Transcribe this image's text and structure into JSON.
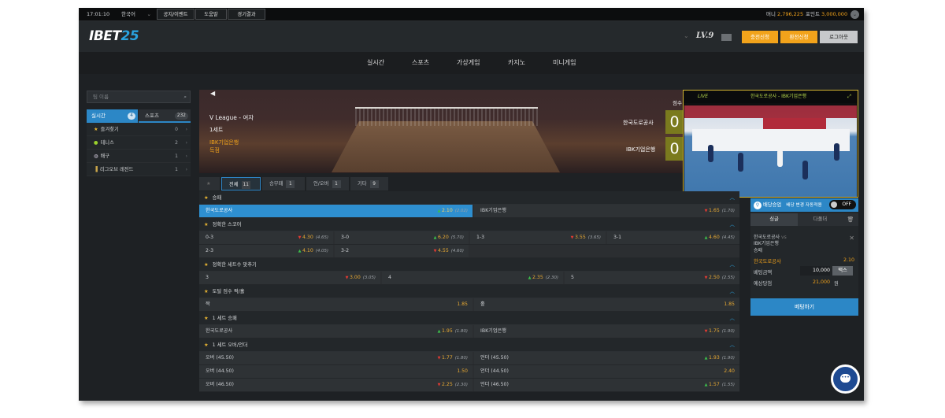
{
  "topbar": {
    "time": "17:01:10",
    "language": "한국어",
    "buttons": [
      "공지/이벤트",
      "도움말",
      "경기결과"
    ],
    "money_label": "머니",
    "money_value": "2,796,225",
    "point_label": "포인트",
    "point_value": "3,000,000"
  },
  "header": {
    "logo_a": "IBET",
    "logo_b": "25",
    "level": "LV.9",
    "deposit": "충전신청",
    "withdraw": "환전신청",
    "logout": "로그아웃"
  },
  "nav": [
    "실시간",
    "스포츠",
    "가상게임",
    "카지노",
    "미니게임"
  ],
  "sidebar": {
    "search_placeholder": "팀 이름",
    "tab_live": "실시간",
    "tab_live_count": "4",
    "tab_sports": "스포츠",
    "tab_sports_count": "232",
    "items": [
      {
        "label": "즐겨찾기",
        "count": "0",
        "icon": "star-icon"
      },
      {
        "label": "테니스",
        "count": "2",
        "icon": "tennis-ball-icon"
      },
      {
        "label": "배구",
        "count": "1",
        "icon": "volleyball-icon"
      },
      {
        "label": "리그오브 레전드",
        "count": "1",
        "icon": "lol-icon"
      }
    ]
  },
  "match": {
    "league": "V League - 여자",
    "period": "1세트",
    "event_team": "IBK기업은행",
    "event_text": "득점",
    "score_header": "점수",
    "home": "한국도로공사",
    "away": "IBK기업은행",
    "home_score": "0",
    "away_score": "0"
  },
  "video": {
    "live": "LIVE",
    "title": "한국도로공사 - IBK기업은행"
  },
  "tabs": [
    {
      "label": "전체",
      "count": "11"
    },
    {
      "label": "승무패",
      "count": "1"
    },
    {
      "label": "언/오버",
      "count": "1"
    },
    {
      "label": "기타",
      "count": "9"
    }
  ],
  "markets": [
    {
      "title": "승패",
      "rows": [
        [
          {
            "label": "한국도로공사",
            "odds": "2.10",
            "prev": "(2.02)",
            "dir": "u",
            "selected": true
          },
          {
            "label": "IBK기업은행",
            "odds": "1.65",
            "prev": "(1.70)",
            "dir": "d"
          }
        ]
      ]
    },
    {
      "title": "정확한 스코어",
      "rows": [
        [
          {
            "label": "0-3",
            "odds": "4.30",
            "prev": "(4.65)",
            "dir": "d"
          },
          {
            "label": "3-0",
            "odds": "6.20",
            "prev": "(5.70)",
            "dir": "u"
          },
          {
            "label": "1-3",
            "odds": "3.55",
            "prev": "(3.65)",
            "dir": "d"
          },
          {
            "label": "3-1",
            "odds": "4.60",
            "prev": "(4.45)",
            "dir": "u"
          }
        ],
        [
          {
            "label": "2-3",
            "odds": "4.10",
            "prev": "(4.05)",
            "dir": "u"
          },
          {
            "label": "3-2",
            "odds": "4.55",
            "prev": "(4.60)",
            "dir": "d"
          }
        ]
      ]
    },
    {
      "title": "정확한 세트수 맞추기",
      "rows": [
        [
          {
            "label": "3",
            "odds": "3.00",
            "prev": "(3.05)",
            "dir": "d"
          },
          {
            "label": "4",
            "odds": "2.35",
            "prev": "(2.30)",
            "dir": "u"
          },
          {
            "label": "5",
            "odds": "2.50",
            "prev": "(2.55)",
            "dir": "d"
          }
        ]
      ]
    },
    {
      "title": "토탈 점수 짝/홀",
      "rows": [
        [
          {
            "label": "짝",
            "odds": "1.85",
            "prev": "",
            "dir": ""
          },
          {
            "label": "홀",
            "odds": "1.85",
            "prev": "",
            "dir": ""
          }
        ]
      ]
    },
    {
      "title": "1 세트 승패",
      "rows": [
        [
          {
            "label": "한국도로공사",
            "odds": "1.95",
            "prev": "(1.80)",
            "dir": "u"
          },
          {
            "label": "IBK기업은행",
            "odds": "1.75",
            "prev": "(1.90)",
            "dir": "d"
          }
        ]
      ]
    },
    {
      "title": "1 세트 오버/언더",
      "rows": [
        [
          {
            "label": "오버 (45.50)",
            "odds": "1.77",
            "prev": "(1.80)",
            "dir": "d"
          },
          {
            "label": "언더 (45.50)",
            "odds": "1.93",
            "prev": "(1.90)",
            "dir": "u"
          }
        ],
        [
          {
            "label": "오버 (44.50)",
            "odds": "1.50",
            "prev": "",
            "dir": ""
          },
          {
            "label": "언더 (44.50)",
            "odds": "2.40",
            "prev": "",
            "dir": ""
          }
        ],
        [
          {
            "label": "오버 (46.50)",
            "odds": "2.25",
            "prev": "(2.30)",
            "dir": "d"
          },
          {
            "label": "언더 (46.50)",
            "odds": "1.57",
            "prev": "(1.55)",
            "dir": "u"
          }
        ]
      ]
    }
  ],
  "betslip": {
    "title": "배당승업",
    "auto": "배당 변경 자동적용",
    "toggle": "OFF",
    "tab_single": "싱글",
    "tab_multi": "다폴더",
    "match": "한국도로공사",
    "vs": "vs",
    "match_away": "IBK기업은행",
    "market": "승패",
    "pick": "한국도로공사",
    "pick_odds": "2.10",
    "amount_label": "베팅금액",
    "amount": "10,000",
    "max": "맥스",
    "win_label": "예상당첨",
    "win": "21,000",
    "won": "원",
    "bet_button": "베팅하기"
  },
  "colors": {
    "accent": "#2c87c6",
    "orange": "#f2a31b",
    "up": "#3cbf4b",
    "down": "#e23b33"
  }
}
